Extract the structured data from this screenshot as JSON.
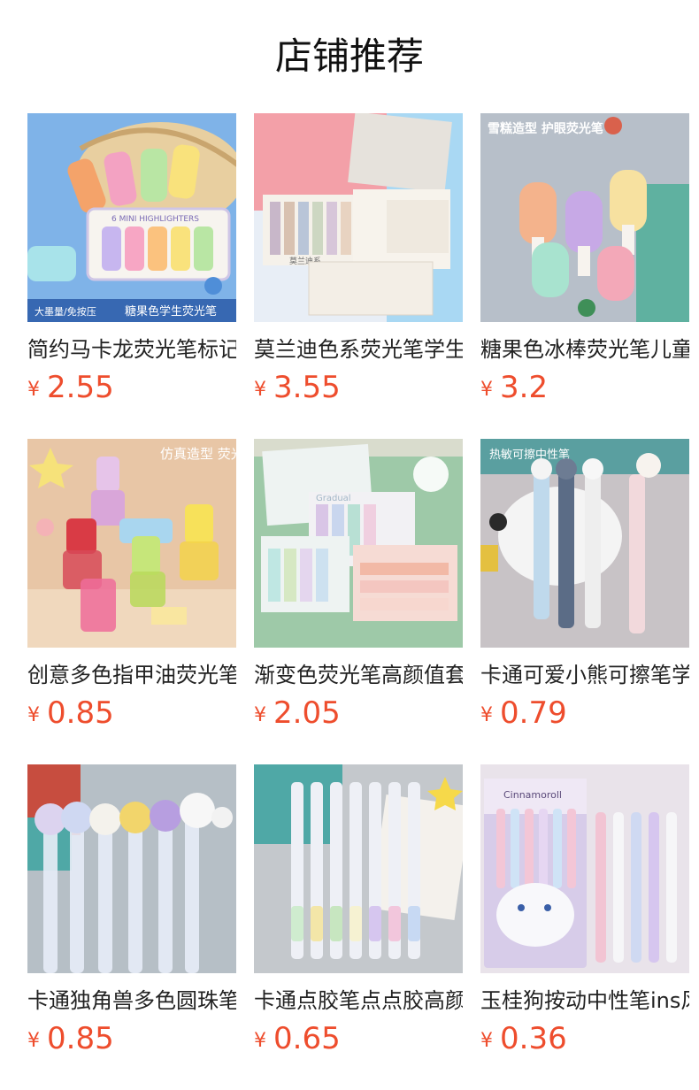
{
  "header": {
    "title": "店铺推荐"
  },
  "currency_symbol": "¥",
  "products": [
    {
      "name": "简约马卡龙荧光笔标记笔",
      "price": "2.55",
      "badge_left": "大墨量/免按压",
      "badge_right": "糖果色学生荧光笔",
      "box_text": "6 MINI HIGHLIGHTERS"
    },
    {
      "name": "莫兰迪色系荧光笔学生用",
      "price": "3.55",
      "box_text": "莫兰迪系"
    },
    {
      "name": "糖果色冰棒荧光笔儿童",
      "price": "3.2",
      "badge_text": "雪糕造型 护眼荧光笔"
    },
    {
      "name": "创意多色指甲油荧光笔",
      "price": "0.85",
      "badge_text": "仿真造型 荧光笔"
    },
    {
      "name": "渐变色荧光笔高颜值套装",
      "price": "2.05",
      "box_text": "Gradual"
    },
    {
      "name": "卡通可爱小熊可擦笔学生",
      "price": "0.79",
      "badge_text": "热敏可擦中性笔"
    },
    {
      "name": "卡通独角兽多色圆珠笔",
      "price": "0.85"
    },
    {
      "name": "卡通点胶笔点点胶高颜值",
      "price": "0.65"
    },
    {
      "name": "玉桂狗按动中性笔ins风",
      "price": "0.36",
      "box_text": "Cinnamoroll"
    }
  ]
}
